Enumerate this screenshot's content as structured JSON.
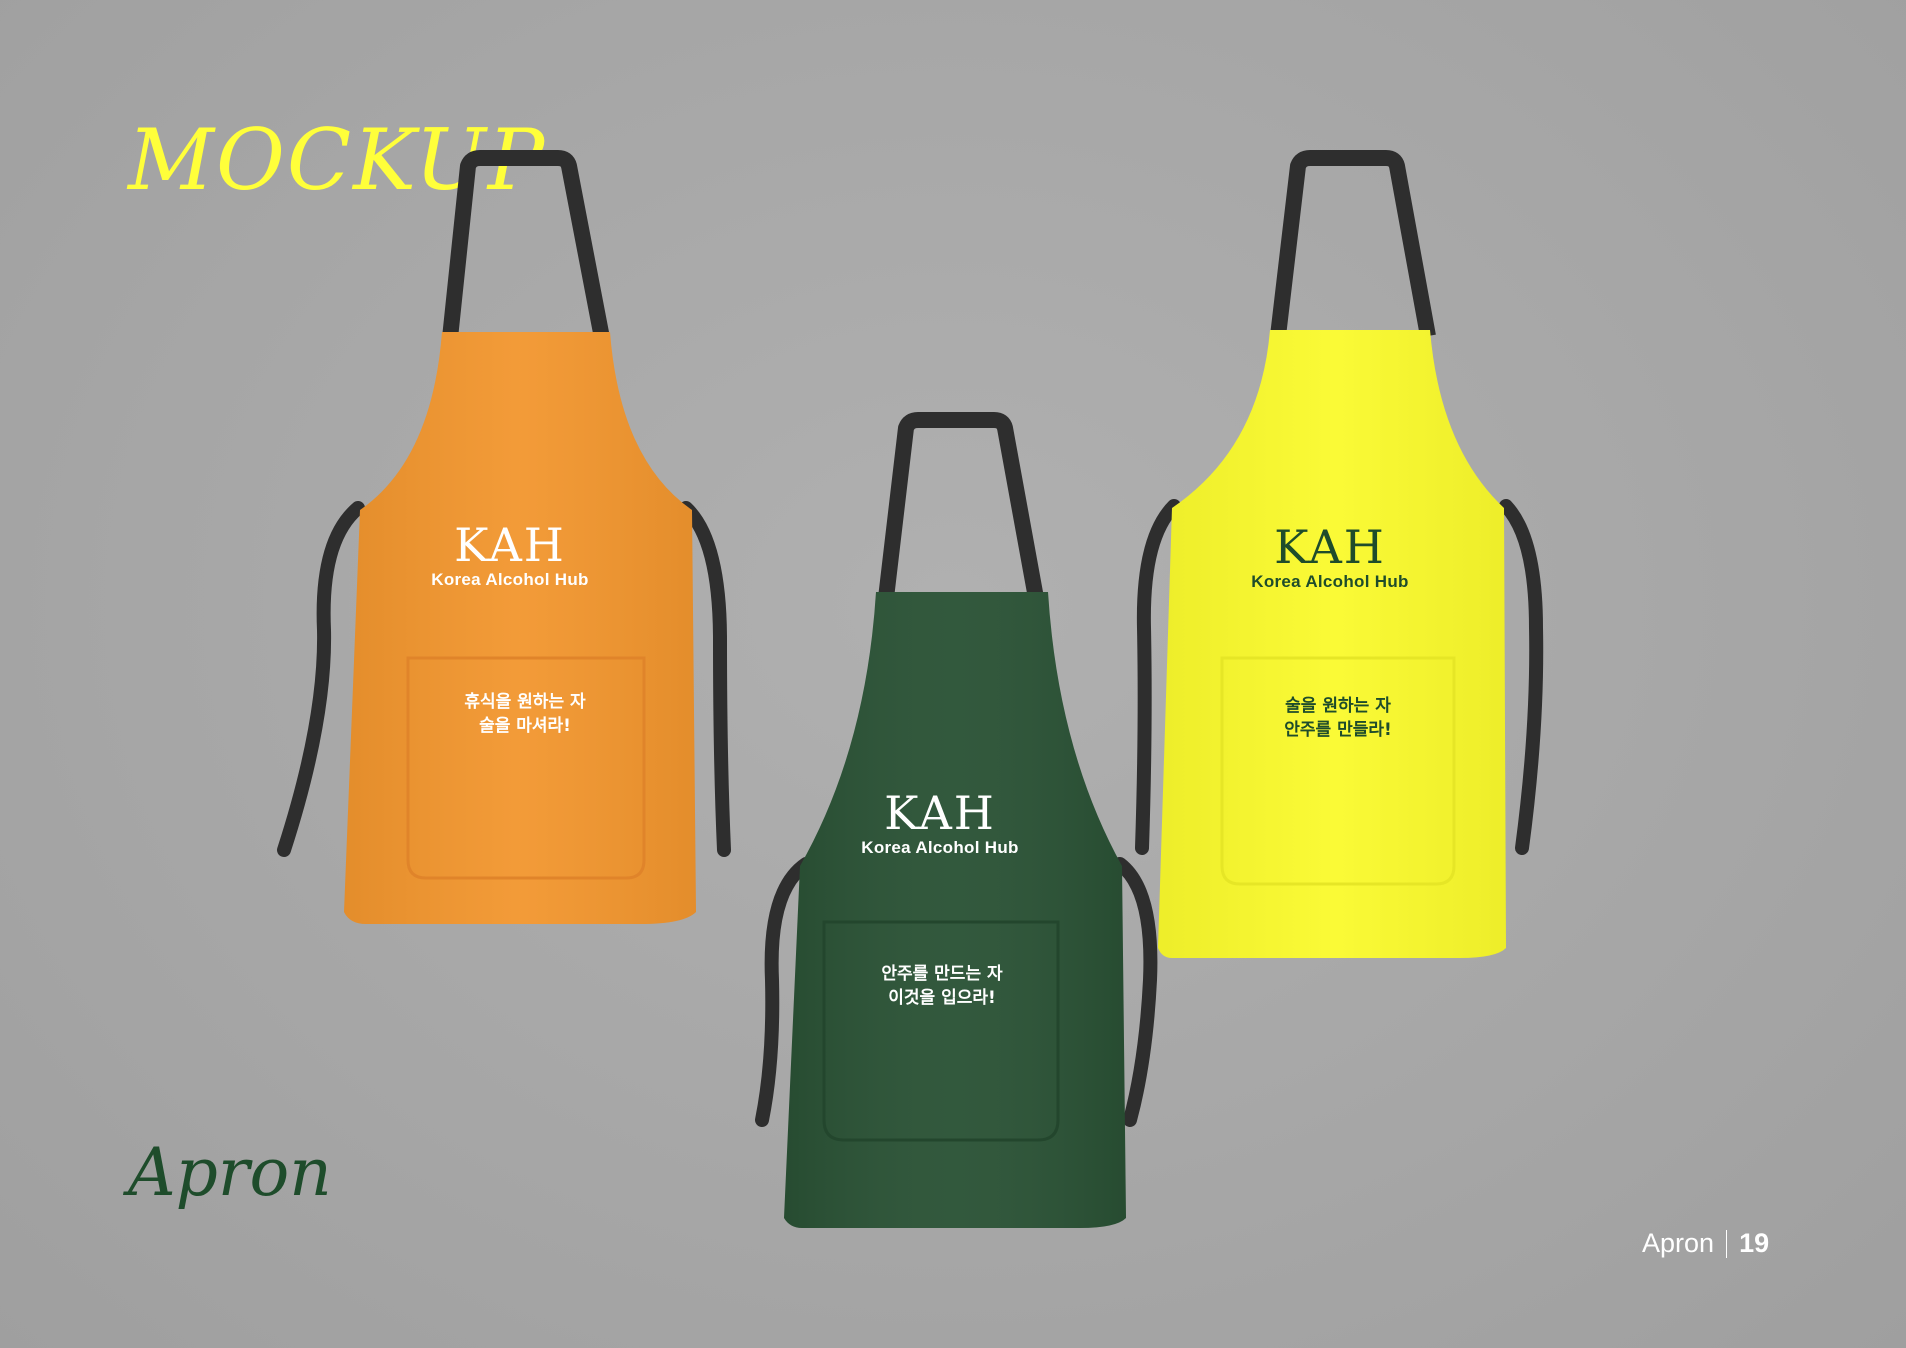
{
  "title": "MOCKUP",
  "subtitle": "Apron",
  "footer": {
    "section": "Apron",
    "page": "19"
  },
  "aprons": [
    {
      "color": "#f2962e",
      "text_color": "#ffffff",
      "logo": "KAH",
      "brand": "Korea Alcohol Hub",
      "pocket_line1": "휴식을 원하는 자",
      "pocket_line2": "술을 마셔라!"
    },
    {
      "color": "#2a5235",
      "text_color": "#ffffff",
      "logo": "KAH",
      "brand": "Korea Alcohol Hub",
      "pocket_line1": "안주를 만드는 자",
      "pocket_line2": "이것을 입으라!"
    },
    {
      "color": "#fafa2c",
      "text_color": "#1e4c2b",
      "logo": "KAH",
      "brand": "Korea Alcohol Hub",
      "pocket_line1": "술을 원하는 자",
      "pocket_line2": "안주를 만들라!"
    }
  ]
}
